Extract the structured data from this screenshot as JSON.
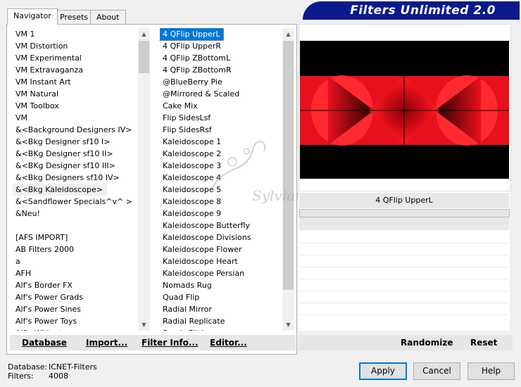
{
  "app": {
    "title": "Filters Unlimited 2.0",
    "watermark": "Sylviane"
  },
  "tabs": [
    {
      "label": "Navigator",
      "active": true
    },
    {
      "label": "Presets",
      "active": false
    },
    {
      "label": "About",
      "active": false
    }
  ],
  "categories": {
    "items": [
      "VM 1",
      "VM Distortion",
      "VM Experimental",
      "VM Extravaganza",
      "VM Instant Art",
      "VM Natural",
      "VM Toolbox",
      "VM",
      "&<Background Designers IV>",
      "&<Bkg Designer sf10 I>",
      "&<BKg Designer sf10 II>",
      "&<BKg Designer sf10 III>",
      "&<Bkg Designers sf10 IV>",
      "&<Bkg Kaleidoscope>",
      "&<Sandflower Specials^v^ >",
      "&Neu!",
      "",
      "[AFS IMPORT]",
      "AB Filters 2000",
      "a",
      "AFH",
      "Alf's Border FX",
      "Alf's Power Grads",
      "Alf's Power Sines",
      "Alf's Power Toys",
      "Alf's Widgets"
    ],
    "selected_index": 13
  },
  "filters": {
    "items": [
      "4 QFlip UpperL",
      "4 QFlip UpperR",
      "4 QFlip ZBottomL",
      "4 QFlip ZBottomR",
      "@BlueBerry Pie",
      "@Mirrored & Scaled",
      "Cake Mix",
      "Flip SidesLsf",
      "Flip SidesRsf",
      "Kaleidoscope 1",
      "Kaleidoscope 2",
      "Kaleidoscope 3",
      "Kaleidoscope 4",
      "Kaleidoscope 5",
      "Kaleidoscope 8",
      "Kaleidoscope 9",
      "Kaleidoscope Butterfly",
      "Kaleidoscope Divisions",
      "Kaleidoscope Flower",
      "Kaleidoscope Heart",
      "Kaleidoscope Persian",
      "Nomads Rug",
      "Quad Flip",
      "Radial Mirror",
      "Radial Replicate",
      "Seeds Flickr"
    ],
    "selected_index": 0
  },
  "toolbar": {
    "database": "Database",
    "import": "Import...",
    "filter_info": "Filter Info...",
    "editor": "Editor..."
  },
  "preview": {
    "filter_name": "4 QFlip UpperL",
    "colors": {
      "red": "#e8101c",
      "dark_red": "#8a0008",
      "background": "#000000"
    }
  },
  "right_toolbar": {
    "randomize": "Randomize",
    "reset": "Reset"
  },
  "status": {
    "database_label": "Database:",
    "database_value": "ICNET-Filters",
    "filters_label": "Filters:",
    "filters_value": "4008"
  },
  "buttons": {
    "apply": "Apply",
    "cancel": "Cancel",
    "help": "Help"
  }
}
